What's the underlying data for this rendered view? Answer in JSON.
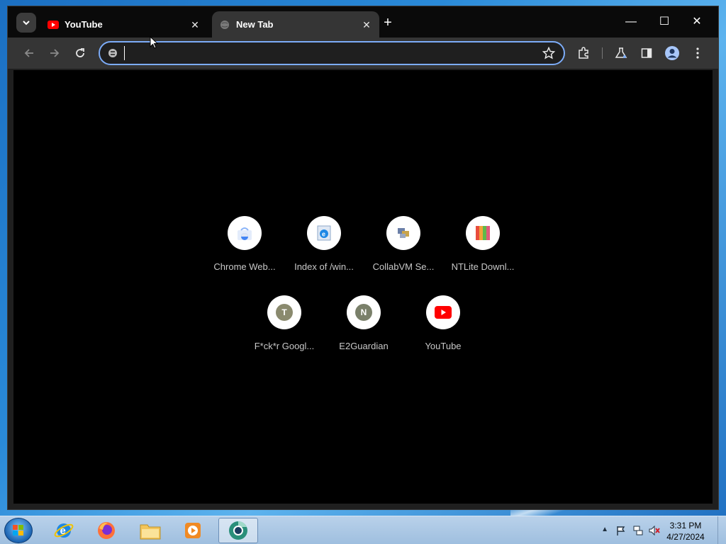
{
  "browser": {
    "tabs": [
      {
        "title": "YouTube",
        "active": false,
        "favicon": "youtube-icon"
      },
      {
        "title": "New Tab",
        "active": true,
        "favicon": "globe-icon"
      }
    ],
    "tab_close_symbol": "✕",
    "new_tab_symbol": "+",
    "window_controls": {
      "minimize": "—",
      "maximize": "☐",
      "close": "✕"
    },
    "omnibox": {
      "value": "",
      "placeholder": ""
    },
    "accent_color": "#7cacf8"
  },
  "shortcuts": [
    {
      "label": "Chrome Web...",
      "icon": "chrome-web-store-icon"
    },
    {
      "label": "Index of /win...",
      "icon": "internet-explorer-icon"
    },
    {
      "label": "CollabVM Se...",
      "icon": "collabvm-icon"
    },
    {
      "label": "NTLite Downl...",
      "icon": "ntlite-icon"
    },
    {
      "label": "F*ck*r Googl...",
      "icon": "letter-badge",
      "letter": "T",
      "color": "#8a8a6e"
    },
    {
      "label": "E2Guardian",
      "icon": "letter-badge",
      "letter": "N",
      "color": "#7a806a"
    },
    {
      "label": "YouTube",
      "icon": "youtube-icon"
    }
  ],
  "taskbar": {
    "apps": [
      "internet-explorer-icon",
      "firefox-icon",
      "file-explorer-icon",
      "media-player-icon",
      "chrome-canary-icon"
    ],
    "clock": {
      "time": "3:31 PM",
      "date": "4/27/2024"
    }
  }
}
